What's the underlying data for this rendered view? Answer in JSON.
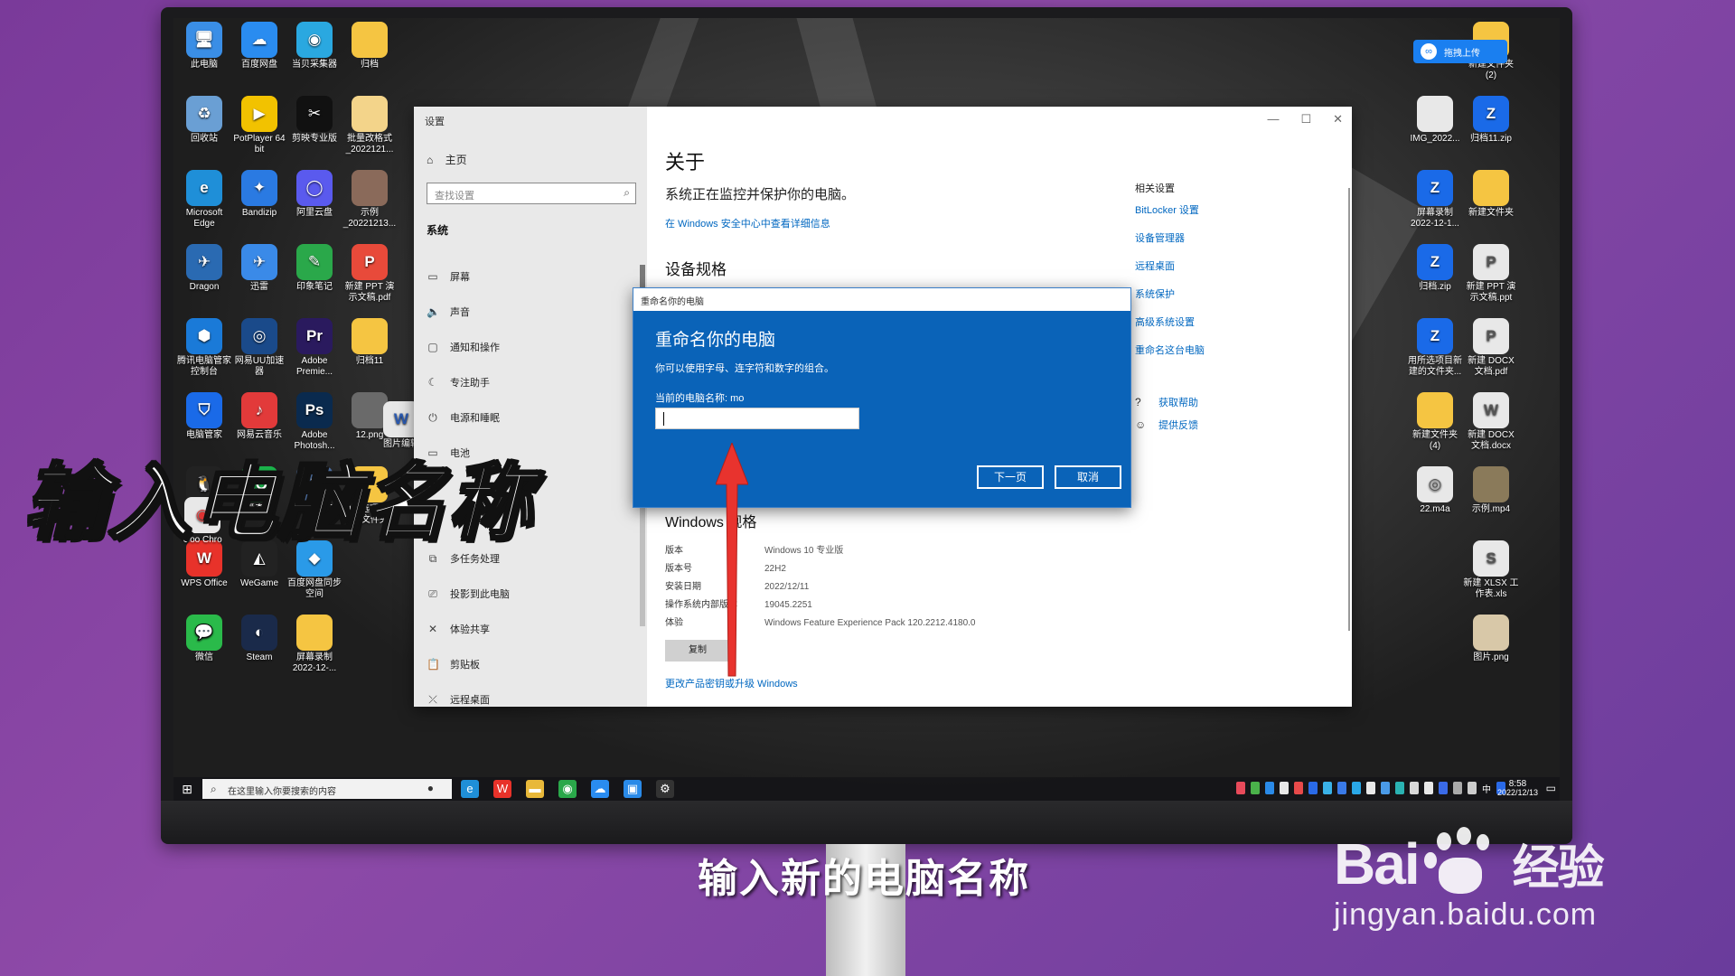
{
  "desktop_icons_left": [
    {
      "label": "此电脑",
      "icon": "pc-icon",
      "glyph": "🖥",
      "color": "#3a8ee6"
    },
    {
      "label": "百度网盘",
      "icon": "baidu-netdisk-icon",
      "glyph": "☁",
      "color": "#2a8cf0"
    },
    {
      "label": "当贝采集器",
      "icon": "collector-icon",
      "glyph": "◉",
      "color": "#2aa8e0"
    },
    {
      "label": "归档",
      "icon": "folder-icon",
      "glyph": "",
      "color": "#f5c542"
    },
    {
      "label": "回收站",
      "icon": "recycle-bin-icon",
      "glyph": "♻",
      "color": "#6a9fd4"
    },
    {
      "label": "PotPlayer 64 bit",
      "icon": "potplayer-icon",
      "glyph": "▶",
      "color": "#f2c200"
    },
    {
      "label": "剪映专业版",
      "icon": "capcut-icon",
      "glyph": "✂",
      "color": "#111111"
    },
    {
      "label": "批量改格式_2022121...",
      "icon": "document-icon",
      "glyph": "",
      "color": "#f3d48a"
    },
    {
      "label": "Microsoft Edge",
      "icon": "edge-icon",
      "glyph": "e",
      "color": "#1f8fd8"
    },
    {
      "label": "Bandizip",
      "icon": "bandizip-icon",
      "glyph": "✦",
      "color": "#2a7ae2"
    },
    {
      "label": "阿里云盘",
      "icon": "aliyun-drive-icon",
      "glyph": "◯",
      "color": "#5a5aee"
    },
    {
      "label": "示例_20221213...",
      "icon": "image-file-icon",
      "glyph": "",
      "color": "#8a6a5a"
    },
    {
      "label": "Dragon",
      "icon": "dragon-icon",
      "glyph": "✈",
      "color": "#2a6ab2"
    },
    {
      "label": "迅雷",
      "icon": "thunder-icon",
      "glyph": "✈",
      "color": "#3a8ae8"
    },
    {
      "label": "印象笔记",
      "icon": "evernote-icon",
      "glyph": "✎",
      "color": "#2aa84a"
    },
    {
      "label": "新建 PPT 演示文稿.pdf",
      "icon": "pdf-icon",
      "glyph": "P",
      "color": "#e84a3a"
    },
    {
      "label": "腾讯电脑管家控制台",
      "icon": "shield-app-icon",
      "glyph": "⬢",
      "color": "#1a7ad8"
    },
    {
      "label": "网易UU加速器",
      "icon": "uu-icon",
      "glyph": "◎",
      "color": "#1a4a8a"
    },
    {
      "label": "Adobe Premie...",
      "icon": "premiere-icon",
      "glyph": "Pr",
      "color": "#2a1a5e"
    },
    {
      "label": "归档11",
      "icon": "folder-icon",
      "glyph": "",
      "color": "#f5c542"
    },
    {
      "label": "电脑管家",
      "icon": "pc-manager-icon",
      "glyph": "⛉",
      "color": "#1a6ae8"
    },
    {
      "label": "网易云音乐",
      "icon": "netease-music-icon",
      "glyph": "♪",
      "color": "#e23a3a"
    },
    {
      "label": "Adobe Photosh...",
      "icon": "photoshop-icon",
      "glyph": "Ps",
      "color": "#0a2a4e"
    },
    {
      "label": "12.png",
      "icon": "image-file-icon",
      "glyph": "",
      "color": "#6a6a6a"
    },
    {
      "label": "腾讯QQ",
      "icon": "qq-icon",
      "glyph": "🐧",
      "color": "#222222"
    },
    {
      "label": "爱奇艺",
      "icon": "iqiyi-icon",
      "glyph": "iQ",
      "color": "#1ab24a"
    },
    {
      "label": "格式工厂",
      "icon": "format-factory-icon",
      "glyph": "⚙",
      "color": "#4a6a9a"
    },
    {
      "label": "用所选项目新建的文件夹 2",
      "icon": "folder-icon",
      "glyph": "",
      "color": "#f5c542"
    },
    {
      "label": "WPS Office",
      "icon": "wps-icon",
      "glyph": "W",
      "color": "#e8322a"
    },
    {
      "label": "WeGame",
      "icon": "wegame-icon",
      "glyph": "◭",
      "color": "#222222"
    },
    {
      "label": "百度网盘同步空间",
      "icon": "sync-space-icon",
      "glyph": "◆",
      "color": "#2a9ae8"
    },
    {
      "label": "",
      "icon": "blank",
      "glyph": "",
      "color": "transparent"
    },
    {
      "label": "微信",
      "icon": "wechat-icon",
      "glyph": "💬",
      "color": "#2aba4a"
    },
    {
      "label": "Steam",
      "icon": "steam-icon",
      "glyph": "◐",
      "color": "#1a2a4a"
    },
    {
      "label": "屏幕录制 2022-12-...",
      "icon": "folder-icon",
      "glyph": "",
      "color": "#f5c542"
    }
  ],
  "partial_icons": [
    {
      "label": "Goo Chro",
      "icon": "chrome-icon"
    },
    {
      "label": "图片编辑",
      "icon": "word-file-icon"
    }
  ],
  "desktop_icons_right": [
    {
      "label": "新建文件夹 (2)",
      "icon": "folder-icon",
      "glyph": "",
      "color": "#f5c542"
    },
    {
      "label": "IMG_2022...",
      "icon": "image-file-icon",
      "glyph": "",
      "color": "#e8e8e8"
    },
    {
      "label": "归档11.zip",
      "icon": "zip-icon",
      "glyph": "Z",
      "color": "#1a6ae8"
    },
    {
      "label": "屏幕录制 2022-12-1...",
      "icon": "zip-icon",
      "glyph": "Z",
      "color": "#1a6ae8"
    },
    {
      "label": "新建文件夹",
      "icon": "folder-icon",
      "glyph": "",
      "color": "#f5c542"
    },
    {
      "label": "归档.zip",
      "icon": "zip-icon",
      "glyph": "Z",
      "color": "#1a6ae8"
    },
    {
      "label": "新建 PPT 演示文稿.ppt",
      "icon": "ppt-icon",
      "glyph": "P",
      "color": "#e8e8e8"
    },
    {
      "label": "用所选项目新建的文件夹...",
      "icon": "zip-icon",
      "glyph": "Z",
      "color": "#1a6ae8"
    },
    {
      "label": "新建 DOCX 文档.pdf",
      "icon": "pdf-icon",
      "glyph": "P",
      "color": "#e8e8e8"
    },
    {
      "label": "新建文件夹 (4)",
      "icon": "folder-icon",
      "glyph": "",
      "color": "#f5c542"
    },
    {
      "label": "新建 DOCX 文档.docx",
      "icon": "docx-icon",
      "glyph": "W",
      "color": "#e8e8e8"
    },
    {
      "label": "22.m4a",
      "icon": "audio-file-icon",
      "glyph": "◎",
      "color": "#e8e8e8"
    },
    {
      "label": "示例.mp4",
      "icon": "video-file-icon",
      "glyph": "",
      "color": "#8a7a5a"
    },
    {
      "label": "新建 XLSX 工作表.xls",
      "icon": "xlsx-icon",
      "glyph": "S",
      "color": "#e8e8e8"
    },
    {
      "label": "图片.png",
      "icon": "image-file-icon",
      "glyph": "",
      "color": "#d8c8a8"
    }
  ],
  "upload_pill": {
    "label": "拖拽上传",
    "icon": "baidu-cloud-icon"
  },
  "settings": {
    "window_title": "设置",
    "home": "主页",
    "search_placeholder": "查找设置",
    "section": "系统",
    "nav": [
      {
        "label": "屏幕",
        "icon": "display-icon",
        "glyph": "▭"
      },
      {
        "label": "声音",
        "icon": "sound-icon",
        "glyph": "🔈"
      },
      {
        "label": "通知和操作",
        "icon": "notification-icon",
        "glyph": "▢"
      },
      {
        "label": "专注助手",
        "icon": "focus-assist-icon",
        "glyph": "☾"
      },
      {
        "label": "电源和睡眠",
        "icon": "power-icon",
        "glyph": "⏻"
      },
      {
        "label": "电池",
        "icon": "battery-icon",
        "glyph": "▭"
      },
      {
        "label": "",
        "icon": "blank",
        "glyph": ""
      },
      {
        "label": "",
        "icon": "blank",
        "glyph": ""
      },
      {
        "label": "多任务处理",
        "icon": "multitasking-icon",
        "glyph": "⧉"
      },
      {
        "label": "投影到此电脑",
        "icon": "project-icon",
        "glyph": "⎚"
      },
      {
        "label": "体验共享",
        "icon": "share-icon",
        "glyph": "✕"
      },
      {
        "label": "剪贴板",
        "icon": "clipboard-icon",
        "glyph": "📋"
      },
      {
        "label": "远程桌面",
        "icon": "remote-desktop-icon",
        "glyph": "⤫"
      }
    ],
    "about_title": "关于",
    "monitor_text": "系统正在监控并保护你的电脑。",
    "security_link": "在 Windows 安全中心中查看详细信息",
    "device_spec_title": "设备规格",
    "windows_spec_title": "Windows 规格",
    "windows_spec_rows": [
      {
        "k": "版本",
        "v": "Windows 10 专业版"
      },
      {
        "k": "版本号",
        "v": "22H2"
      },
      {
        "k": "安装日期",
        "v": "2022/12/11"
      },
      {
        "k": "操作系统内部版本",
        "v": "19045.2251"
      },
      {
        "k": "体验",
        "v": "Windows Feature Experience Pack 120.2212.4180.0"
      }
    ],
    "copy_button": "复制",
    "upgrade_link": "更改产品密钥或升级 Windows",
    "related_heading": "相关设置",
    "related_links": [
      "BitLocker 设置",
      "设备管理器",
      "远程桌面",
      "系统保护",
      "高级系统设置",
      "重命名这台电脑"
    ],
    "help_links": [
      {
        "label": "获取帮助",
        "icon": "help-icon",
        "glyph": "?"
      },
      {
        "label": "提供反馈",
        "icon": "feedback-icon",
        "glyph": "☺"
      }
    ]
  },
  "dialog": {
    "titlebar": "重命名你的电脑",
    "heading": "重命名你的电脑",
    "subtitle": "你可以使用字母、连字符和数字的组合。",
    "current_name": "当前的电脑名称: mo",
    "input_value": "",
    "next_button": "下一页",
    "cancel_button": "取消"
  },
  "taskbar": {
    "search_placeholder": "在这里输入你要搜索的内容",
    "time": "8:58",
    "date": "2022/12/13",
    "ime": "中",
    "apps": [
      {
        "icon": "edge-icon",
        "glyph": "e",
        "color": "#1f8fd8"
      },
      {
        "icon": "wps-icon",
        "glyph": "W",
        "color": "#e8322a"
      },
      {
        "icon": "file-explorer-icon",
        "glyph": "▬",
        "color": "#e8b83a"
      },
      {
        "icon": "browser-icon",
        "glyph": "◉",
        "color": "#2aa84a"
      },
      {
        "icon": "baidu-netdisk-icon",
        "glyph": "☁",
        "color": "#2a8cf0"
      },
      {
        "icon": "pc-manager-icon",
        "glyph": "▣",
        "color": "#2a8ae8"
      },
      {
        "icon": "settings-gear-icon",
        "glyph": "⚙",
        "color": "#333333"
      }
    ]
  },
  "overlay": {
    "big_caption": "输入电脑名称",
    "subtitle": "输入新的电脑名称",
    "watermark_brand": "Bai",
    "watermark_cn": "经验",
    "watermark_url": "jingyan.baidu.com"
  }
}
